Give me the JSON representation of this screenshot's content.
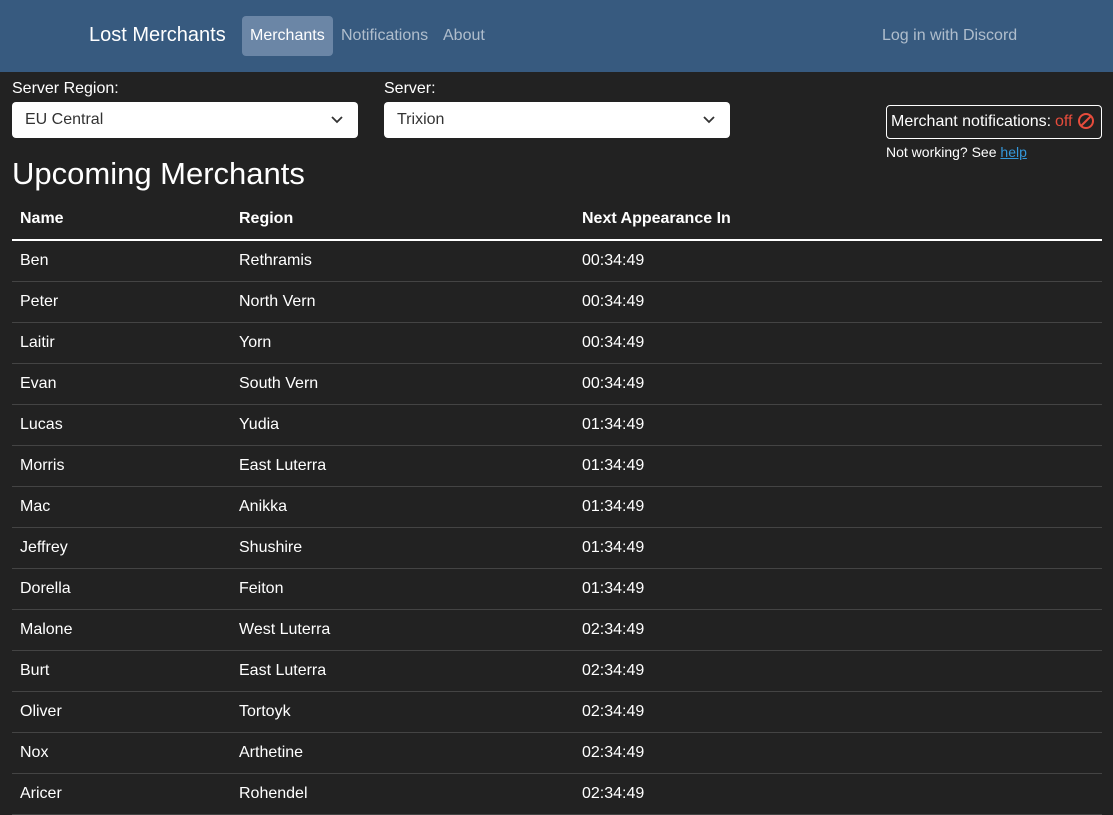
{
  "navbar": {
    "brand": "Lost Merchants",
    "links": [
      {
        "label": "Merchants",
        "active": true
      },
      {
        "label": "Notifications",
        "active": false
      },
      {
        "label": "About",
        "active": false
      }
    ],
    "login": "Log in with Discord",
    "background_color": "#375a7f"
  },
  "filters": {
    "region_label": "Server Region:",
    "region_value": "EU Central",
    "server_label": "Server:",
    "server_value": "Trixion"
  },
  "notifications": {
    "label": "Merchant notifications:",
    "state": "off",
    "state_color": "#e74c3c",
    "icon": "prohibited-icon",
    "help_prefix": "Not working? See",
    "help_link": "help",
    "help_link_color": "#3498db"
  },
  "page_title": "Upcoming Merchants",
  "table": {
    "headers": [
      "Name",
      "Region",
      "Next Appearance In"
    ],
    "rows": [
      {
        "name": "Ben",
        "region": "Rethramis",
        "time": "00:34:49"
      },
      {
        "name": "Peter",
        "region": "North Vern",
        "time": "00:34:49"
      },
      {
        "name": "Laitir",
        "region": "Yorn",
        "time": "00:34:49"
      },
      {
        "name": "Evan",
        "region": "South Vern",
        "time": "00:34:49"
      },
      {
        "name": "Lucas",
        "region": "Yudia",
        "time": "01:34:49"
      },
      {
        "name": "Morris",
        "region": "East Luterra",
        "time": "01:34:49"
      },
      {
        "name": "Mac",
        "region": "Anikka",
        "time": "01:34:49"
      },
      {
        "name": "Jeffrey",
        "region": "Shushire",
        "time": "01:34:49"
      },
      {
        "name": "Dorella",
        "region": "Feiton",
        "time": "01:34:49"
      },
      {
        "name": "Malone",
        "region": "West Luterra",
        "time": "02:34:49"
      },
      {
        "name": "Burt",
        "region": "East Luterra",
        "time": "02:34:49"
      },
      {
        "name": "Oliver",
        "region": "Tortoyk",
        "time": "02:34:49"
      },
      {
        "name": "Nox",
        "region": "Arthetine",
        "time": "02:34:49"
      },
      {
        "name": "Aricer",
        "region": "Rohendel",
        "time": "02:34:49"
      }
    ]
  }
}
